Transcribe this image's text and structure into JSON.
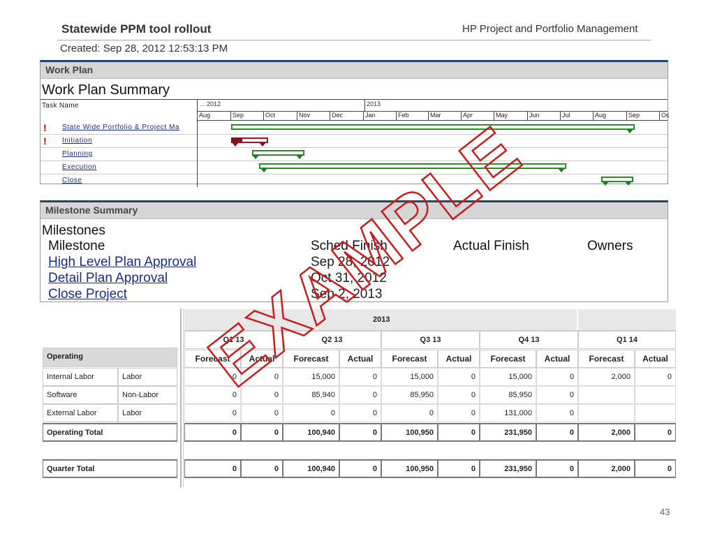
{
  "header": {
    "title": "Statewide PPM tool rollout",
    "product": "HP Project and Portfolio Management",
    "created": "Created: Sep 28, 2012 12:53:13 PM"
  },
  "work_plan": {
    "section_title": "Work Plan",
    "summary_title": "Work Plan Summary",
    "task_header": "Task Name",
    "year_labels": [
      "... 2012",
      "2013"
    ],
    "months": [
      "Aug",
      "Sep",
      "Oct",
      "Nov",
      "Dec",
      "Jan",
      "Feb",
      "Mar",
      "Apr",
      "May",
      "Jun",
      "Jul",
      "Aug",
      "Sep",
      "Oc"
    ],
    "tasks": [
      {
        "name": "State Wide Portfolio & Project Ma",
        "flag": "!"
      },
      {
        "name": "Initiation",
        "flag": "!"
      },
      {
        "name": "Planning",
        "flag": ""
      },
      {
        "name": "Execution",
        "flag": ""
      },
      {
        "name": "Close",
        "flag": ""
      }
    ]
  },
  "milestones": {
    "section_title": "Milestone Summary",
    "title": "Milestones",
    "columns": [
      "Milestone",
      "Sched Finish",
      "Actual Finish",
      "Owners"
    ],
    "rows": [
      {
        "name": "High Level Plan Approval",
        "sched": "Sep 28, 2012"
      },
      {
        "name": "Detail Plan Approval",
        "sched": "Oct 31, 2012"
      },
      {
        "name": "Close Project",
        "sched": "Sep 2, 2013"
      }
    ]
  },
  "financials": {
    "year": "2013",
    "quarters": [
      "Q1 13",
      "Q2 13",
      "Q3 13",
      "Q4 13",
      "Q1 14"
    ],
    "sub_forecast": "Forecast",
    "sub_actual": "Actual",
    "section_label": "Operating",
    "rows": [
      {
        "name": "Internal Labor",
        "type": "Labor",
        "values": [
          "0",
          "0",
          "15,000",
          "0",
          "15,000",
          "0",
          "15,000",
          "0",
          "2,000",
          "0"
        ]
      },
      {
        "name": "Software",
        "type": "Non-Labor",
        "values": [
          "0",
          "0",
          "85,940",
          "0",
          "85,950",
          "0",
          "85,950",
          "0",
          "",
          ""
        ]
      },
      {
        "name": "External Labor",
        "type": "Labor",
        "values": [
          "0",
          "0",
          "0",
          "0",
          "0",
          "0",
          "131,000",
          "0",
          "",
          ""
        ]
      }
    ],
    "operating_total": {
      "label": "Operating Total",
      "values": [
        "0",
        "0",
        "100,940",
        "0",
        "100,950",
        "0",
        "231,950",
        "0",
        "2,000",
        "0"
      ]
    },
    "quarter_total": {
      "label": "Quarter Total",
      "values": [
        "0",
        "0",
        "100,940",
        "0",
        "100,950",
        "0",
        "231,950",
        "0",
        "2,000",
        "0"
      ]
    }
  },
  "watermark": "EXAMPLE",
  "watermark_color": "#c81e1e",
  "page_number": "43"
}
